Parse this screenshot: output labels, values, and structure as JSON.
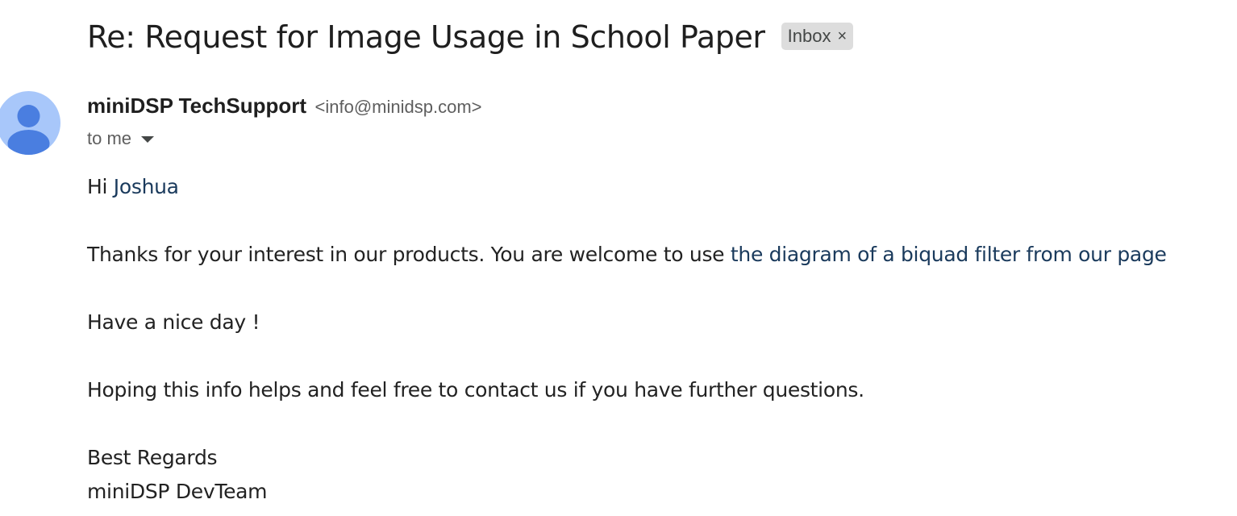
{
  "email": {
    "subject": "Re: Request for Image Usage in School Paper",
    "label": "Inbox",
    "label_remove_icon": "×",
    "sender": {
      "name": "miniDSP TechSupport",
      "email": "<info@minidsp.com>",
      "avatar_icon": "person-icon"
    },
    "recipient": "to me",
    "body": {
      "greeting_prefix": "Hi ",
      "greeting_name": "Joshua",
      "thanks_text": "Thanks for your interest in our products. You are welcome to use ",
      "thanks_link": "the diagram of a biquad filter from our page",
      "closing_wish": "Have a nice day !",
      "help_text": "Hoping this info helps and feel free to contact us if you have further questions.",
      "signoff": "Best Regards",
      "signature": "miniDSP DevTeam"
    }
  },
  "colors": {
    "avatar_bg": "#a8c7fa",
    "avatar_fg": "#4a7ee0",
    "label_chip_bg": "#dddddd",
    "link": "#1a3a5c"
  }
}
